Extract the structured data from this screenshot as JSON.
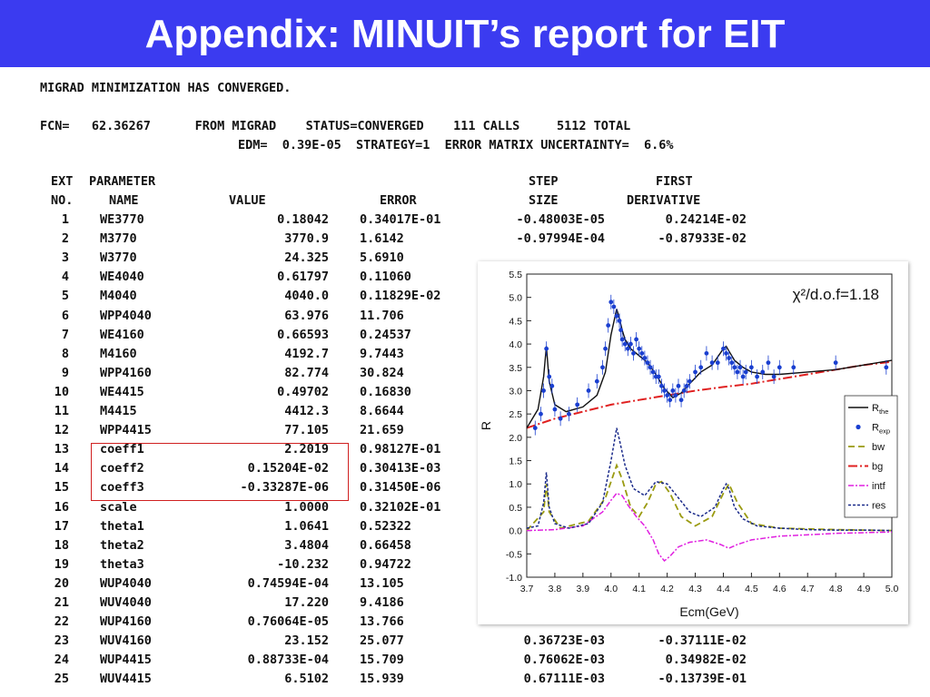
{
  "slide": {
    "title": "Appendix: MINUIT’s report for EIT",
    "accent_color": "#3b3bf0",
    "highlight_color": "#d02020"
  },
  "report": {
    "converged_line": "MIGRAD MINIMIZATION HAS CONVERGED.",
    "fcn_line": "FCN=   62.36267      FROM MIGRAD    STATUS=CONVERGED    111 CALLS     5112 TOTAL",
    "edm_line": "EDM=  0.39E-05  STRATEGY=1  ERROR MATRIX UNCERTAINTY=  6.6%"
  },
  "table": {
    "header_row1": {
      "c1": "EXT",
      "c2": "PARAMETER",
      "c5": "STEP",
      "c6": "FIRST"
    },
    "header_row2": {
      "c1": "NO.",
      "c2": "NAME",
      "c3": "VALUE",
      "c4": "ERROR",
      "c5": "SIZE",
      "c6": "DERIVATIVE"
    },
    "rows": [
      {
        "no": "1",
        "name": "WE3770",
        "value": "0.18042",
        "error": "0.34017E-01",
        "step": "-0.48003E-05",
        "deriv": "0.24214E-02"
      },
      {
        "no": "2",
        "name": "M3770",
        "value": "3770.9",
        "error": "1.6142",
        "step": "-0.97994E-04",
        "deriv": "-0.87933E-02"
      },
      {
        "no": "3",
        "name": "W3770",
        "value": "24.325",
        "error": "5.6910",
        "step": "",
        "deriv": ""
      },
      {
        "no": "4",
        "name": "WE4040",
        "value": "0.61797",
        "error": "0.11060",
        "step": "",
        "deriv": ""
      },
      {
        "no": "5",
        "name": "M4040",
        "value": "4040.0",
        "error": "0.11829E-02",
        "step": "",
        "deriv": ""
      },
      {
        "no": "6",
        "name": "WPP4040",
        "value": "63.976",
        "error": "11.706",
        "step": "",
        "deriv": ""
      },
      {
        "no": "7",
        "name": "WE4160",
        "value": "0.66593",
        "error": "0.24537",
        "step": "",
        "deriv": ""
      },
      {
        "no": "8",
        "name": "M4160",
        "value": "4192.7",
        "error": "9.7443",
        "step": "",
        "deriv": ""
      },
      {
        "no": "9",
        "name": "WPP4160",
        "value": "82.774",
        "error": "30.824",
        "step": "",
        "deriv": ""
      },
      {
        "no": "10",
        "name": "WE4415",
        "value": "0.49702",
        "error": "0.16830",
        "step": "",
        "deriv": ""
      },
      {
        "no": "11",
        "name": "M4415",
        "value": "4412.3",
        "error": "8.6644",
        "step": "",
        "deriv": ""
      },
      {
        "no": "12",
        "name": "WPP4415",
        "value": "77.105",
        "error": "21.659",
        "step": "",
        "deriv": ""
      },
      {
        "no": "13",
        "name": "coeff1",
        "value": "2.2019",
        "error": "0.98127E-01",
        "step": "",
        "deriv": ""
      },
      {
        "no": "14",
        "name": "coeff2",
        "value": "0.15204E-02",
        "error": "0.30413E-03",
        "step": "",
        "deriv": ""
      },
      {
        "no": "15",
        "name": "coeff3",
        "value": "-0.33287E-06",
        "error": "0.31450E-06",
        "step": "",
        "deriv": ""
      },
      {
        "no": "16",
        "name": "scale",
        "value": "1.0000",
        "error": "0.32102E-01",
        "step": "",
        "deriv": ""
      },
      {
        "no": "17",
        "name": "theta1",
        "value": "1.0641",
        "error": "0.52322",
        "step": "",
        "deriv": ""
      },
      {
        "no": "18",
        "name": "theta2",
        "value": "3.4804",
        "error": "0.66458",
        "step": "",
        "deriv": ""
      },
      {
        "no": "19",
        "name": "theta3",
        "value": "-10.232",
        "error": "0.94722",
        "step": "",
        "deriv": ""
      },
      {
        "no": "20",
        "name": "WUP4040",
        "value": "0.74594E-04",
        "error": "13.105",
        "step": "",
        "deriv": ""
      },
      {
        "no": "21",
        "name": "WUV4040",
        "value": "17.220",
        "error": "9.4186",
        "step": "",
        "deriv": ""
      },
      {
        "no": "22",
        "name": "WUP4160",
        "value": "0.76064E-05",
        "error": "13.766",
        "step": "",
        "deriv": ""
      },
      {
        "no": "23",
        "name": "WUV4160",
        "value": "23.152",
        "error": "25.077",
        "step": "0.36723E-03",
        "deriv": "-0.37111E-02"
      },
      {
        "no": "24",
        "name": "WUP4415",
        "value": "0.88733E-04",
        "error": "15.709",
        "step": "0.76062E-03",
        "deriv": "0.34982E-02"
      },
      {
        "no": "25",
        "name": "WUV4415",
        "value": "6.5102",
        "error": "15.939",
        "step": "0.67111E-03",
        "deriv": "-0.13739E-01"
      }
    ]
  },
  "chart_data": {
    "type": "line",
    "xlabel": "Ecm(GeV)",
    "ylabel": "R",
    "xlim": [
      3.7,
      5.0
    ],
    "ylim": [
      -1.0,
      5.5
    ],
    "xticks": [
      "3.7",
      "3.8",
      "3.9",
      "4.0",
      "4.1",
      "4.2",
      "4.3",
      "4.4",
      "4.5",
      "4.6",
      "4.7",
      "4.8",
      "4.9",
      "5.0"
    ],
    "yticks": [
      "-1.0",
      "-0.5",
      "0.0",
      "0.5",
      "1.0",
      "1.5",
      "2.0",
      "2.5",
      "3.0",
      "3.5",
      "4.0",
      "4.5",
      "5.0",
      "5.5"
    ],
    "annotation": "χ²/d.o.f=1.18",
    "legend_position": "right",
    "legend": [
      {
        "label": "R",
        "sub": "the"
      },
      {
        "label": "R",
        "sub": "exp"
      },
      {
        "label": "bw",
        "sub": ""
      },
      {
        "label": "bg",
        "sub": ""
      },
      {
        "label": "intf",
        "sub": ""
      },
      {
        "label": "res",
        "sub": ""
      }
    ],
    "colors": {
      "R_the": "#111111",
      "R_exp": "#1a3fd0",
      "bw": "#9a9a10",
      "bg": "#e02020",
      "intf": "#e020e0",
      "res": "#1a2a8a"
    },
    "series": [
      {
        "name": "R_exp",
        "x": [
          3.73,
          3.75,
          3.76,
          3.77,
          3.78,
          3.79,
          3.8,
          3.82,
          3.85,
          3.88,
          3.92,
          3.95,
          3.97,
          3.98,
          3.99,
          4.0,
          4.01,
          4.02,
          4.03,
          4.035,
          4.04,
          4.05,
          4.06,
          4.07,
          4.08,
          4.09,
          4.1,
          4.11,
          4.12,
          4.13,
          4.14,
          4.15,
          4.16,
          4.17,
          4.18,
          4.19,
          4.2,
          4.21,
          4.22,
          4.23,
          4.24,
          4.25,
          4.26,
          4.27,
          4.28,
          4.3,
          4.32,
          4.34,
          4.36,
          4.38,
          4.4,
          4.41,
          4.42,
          4.43,
          4.44,
          4.45,
          4.46,
          4.47,
          4.48,
          4.5,
          4.52,
          4.54,
          4.56,
          4.58,
          4.6,
          4.65,
          4.8,
          4.98
        ],
        "y": [
          2.2,
          2.5,
          3.0,
          3.9,
          3.3,
          3.1,
          2.6,
          2.4,
          2.5,
          2.7,
          3.0,
          3.2,
          3.5,
          3.9,
          4.4,
          4.9,
          4.8,
          4.6,
          4.5,
          4.3,
          4.1,
          4.0,
          3.9,
          4.0,
          3.8,
          4.1,
          3.9,
          3.8,
          3.7,
          3.6,
          3.5,
          3.4,
          3.3,
          3.3,
          3.1,
          3.0,
          2.9,
          2.8,
          3.0,
          2.9,
          3.1,
          2.8,
          3.0,
          3.1,
          3.2,
          3.4,
          3.5,
          3.8,
          3.6,
          3.6,
          3.9,
          3.8,
          3.7,
          3.6,
          3.5,
          3.4,
          3.5,
          3.3,
          3.4,
          3.5,
          3.3,
          3.4,
          3.6,
          3.3,
          3.5,
          3.5,
          3.6,
          3.5
        ]
      },
      {
        "name": "R_the",
        "x": [
          3.7,
          3.74,
          3.76,
          3.77,
          3.78,
          3.8,
          3.84,
          3.9,
          3.95,
          3.98,
          4.0,
          4.02,
          4.03,
          4.04,
          4.05,
          4.07,
          4.1,
          4.13,
          4.16,
          4.19,
          4.22,
          4.25,
          4.28,
          4.32,
          4.36,
          4.4,
          4.41,
          4.42,
          4.44,
          4.47,
          4.5,
          4.55,
          4.6,
          4.7,
          4.8,
          4.9,
          5.0
        ],
        "y": [
          2.2,
          2.6,
          3.3,
          3.95,
          3.2,
          2.7,
          2.55,
          2.65,
          2.9,
          3.4,
          4.2,
          4.75,
          4.55,
          4.3,
          4.1,
          3.9,
          3.75,
          3.6,
          3.35,
          3.05,
          2.85,
          2.95,
          3.15,
          3.4,
          3.55,
          3.9,
          3.95,
          3.85,
          3.65,
          3.5,
          3.4,
          3.35,
          3.35,
          3.4,
          3.45,
          3.55,
          3.65
        ]
      },
      {
        "name": "bg",
        "x": [
          3.7,
          3.8,
          3.9,
          4.0,
          4.1,
          4.2,
          4.3,
          4.4,
          4.5,
          4.6,
          4.7,
          4.8,
          4.9,
          5.0
        ],
        "y": [
          2.2,
          2.4,
          2.55,
          2.7,
          2.8,
          2.9,
          3.0,
          3.08,
          3.15,
          3.25,
          3.35,
          3.45,
          3.55,
          3.62
        ]
      },
      {
        "name": "res",
        "x": [
          3.7,
          3.74,
          3.76,
          3.77,
          3.78,
          3.8,
          3.85,
          3.92,
          3.97,
          4.0,
          4.02,
          4.03,
          4.05,
          4.08,
          4.12,
          4.16,
          4.2,
          4.24,
          4.28,
          4.32,
          4.37,
          4.4,
          4.41,
          4.42,
          4.44,
          4.47,
          4.52,
          4.6,
          4.7,
          4.8,
          4.9,
          5.0
        ],
        "y": [
          0.05,
          0.1,
          0.6,
          1.25,
          0.5,
          0.15,
          0.05,
          0.15,
          0.6,
          1.5,
          2.2,
          1.95,
          1.4,
          0.9,
          0.75,
          1.05,
          1.0,
          0.7,
          0.4,
          0.3,
          0.5,
          0.9,
          1.0,
          0.9,
          0.5,
          0.25,
          0.1,
          0.05,
          0.02,
          0.01,
          0.01,
          0.0
        ]
      },
      {
        "name": "bw",
        "x": [
          3.7,
          3.76,
          3.77,
          3.78,
          3.82,
          3.92,
          3.98,
          4.02,
          4.04,
          4.07,
          4.1,
          4.13,
          4.16,
          4.18,
          4.21,
          4.25,
          4.3,
          4.36,
          4.4,
          4.42,
          4.45,
          4.5,
          4.6,
          4.8,
          5.0
        ],
        "y": [
          0.0,
          0.4,
          1.0,
          0.4,
          0.05,
          0.2,
          0.7,
          1.4,
          1.1,
          0.5,
          0.3,
          0.6,
          1.0,
          1.05,
          0.8,
          0.3,
          0.1,
          0.3,
          0.8,
          1.0,
          0.6,
          0.15,
          0.05,
          0.02,
          0.0
        ]
      },
      {
        "name": "intf",
        "x": [
          3.7,
          3.8,
          3.9,
          3.97,
          4.0,
          4.02,
          4.04,
          4.06,
          4.09,
          4.12,
          4.15,
          4.17,
          4.19,
          4.21,
          4.24,
          4.28,
          4.34,
          4.39,
          4.42,
          4.45,
          4.5,
          4.6,
          4.8,
          5.0
        ],
        "y": [
          0.0,
          0.02,
          0.1,
          0.4,
          0.65,
          0.8,
          0.75,
          0.55,
          0.3,
          0.1,
          -0.2,
          -0.5,
          -0.65,
          -0.55,
          -0.35,
          -0.25,
          -0.2,
          -0.3,
          -0.38,
          -0.3,
          -0.2,
          -0.12,
          -0.06,
          -0.03
        ]
      }
    ]
  }
}
